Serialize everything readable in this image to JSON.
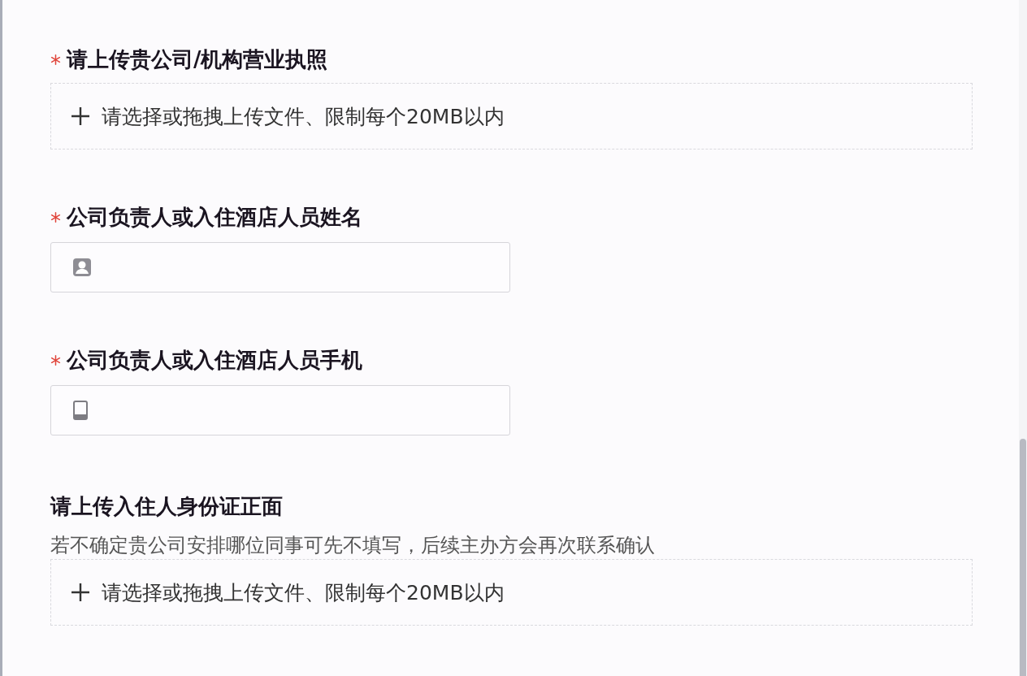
{
  "fields": [
    {
      "kind": "upload",
      "required": true,
      "label": "请上传贵公司/机构营业执照",
      "upload_text": "请选择或拖拽上传文件、限制每个20MB以内"
    },
    {
      "kind": "name",
      "required": true,
      "label": "公司负责人或入住酒店人员姓名"
    },
    {
      "kind": "phone",
      "required": true,
      "label": "公司负责人或入住酒店人员手机"
    },
    {
      "kind": "upload",
      "required": false,
      "label": "请上传入住人身份证正面",
      "hint": "若不确定贵公司安排哪位同事可先不填写，后续主办方会再次联系确认",
      "upload_text": "请选择或拖拽上传文件、限制每个20MB以内"
    }
  ]
}
